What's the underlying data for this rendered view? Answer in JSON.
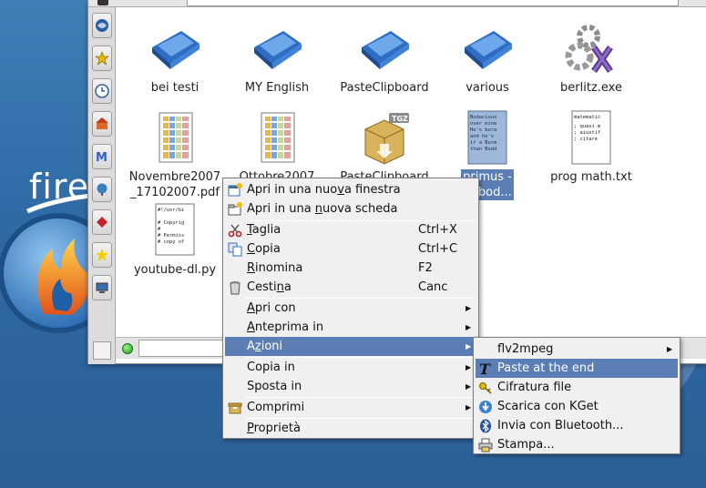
{
  "desktop": {
    "logo_text": "fire"
  },
  "files": [
    {
      "label": "bei testi",
      "icon": "blue-folder-icon"
    },
    {
      "label": "MY English",
      "icon": "blue-folder-icon"
    },
    {
      "label": "PasteClipboard",
      "icon": "blue-folder-icon"
    },
    {
      "label": "various",
      "icon": "blue-folder-icon"
    },
    {
      "label": "berlitz.exe",
      "icon": "gear-executable-icon"
    },
    {
      "label": "Novembre2007",
      "label2": "_17102007.pdf",
      "icon": "pdf-document-icon"
    },
    {
      "label": "Ottobre2007",
      "icon": "pdf-document-icon"
    },
    {
      "label": "PasteClipboard",
      "icon": "tgz-archive-icon"
    },
    {
      "label": "primus -",
      "label2": "of bod...",
      "icon": "text-file-preview-icon",
      "preview": [
        "Bodacious",
        "over mine",
        "He's bora",
        "and he's",
        "if a Burm",
        "than Bodd"
      ]
    },
    {
      "label": "prog math.txt",
      "icon": "text-file-preview-icon",
      "preview": [
        "matematic",
        ";  quasi m",
        ";  aiustif",
        ";  citare"
      ]
    },
    {
      "label": "youtube-dl.py",
      "icon": "python-script-icon",
      "preview": [
        "#!/usr/bi",
        "",
        "# Copyrig",
        "#",
        "# Permiss",
        "# copy of"
      ]
    }
  ],
  "context_menu": {
    "new_window": {
      "pre": "Apri in una nuo",
      "mn": "v",
      "post": "a finestra"
    },
    "new_tab": {
      "pre": "Apri in una ",
      "mn": "n",
      "post": "uova scheda"
    },
    "cut": {
      "pre": "",
      "mn": "T",
      "post": "aglia",
      "shortcut": "Ctrl+X"
    },
    "copy": {
      "pre": "",
      "mn": "C",
      "post": "opia",
      "shortcut": "Ctrl+C"
    },
    "rename": {
      "pre": "",
      "mn": "R",
      "post": "inomina",
      "shortcut": "F2"
    },
    "trash": {
      "pre": "Cesti",
      "mn": "n",
      "post": "a",
      "shortcut": "Canc"
    },
    "open_with": {
      "pre": "",
      "mn": "A",
      "post": "pri con"
    },
    "preview_in": {
      "pre": "",
      "mn": "A",
      "post": "nteprima in"
    },
    "actions": {
      "pre": "A",
      "mn": "z",
      "post": "ioni"
    },
    "copy_to": {
      "pre": "Copia in",
      "mn": "",
      "post": ""
    },
    "move_to": {
      "pre": "Sposta in",
      "mn": "",
      "post": ""
    },
    "compress": {
      "pre": "Comprimi",
      "mn": "",
      "post": ""
    },
    "properties": {
      "pre": "",
      "mn": "P",
      "post": "roprietà"
    }
  },
  "actions_submenu": {
    "flv2mpeg": "flv2mpeg",
    "paste_end": "Paste at the end",
    "encrypt": "Cifratura file",
    "kget": "Scarica con KGet",
    "bluetooth": "Invia con Bluetooth...",
    "print": "Stampa..."
  },
  "colors": {
    "highlight": "#5b7fb4",
    "menu_bg": "#f0f0f0",
    "desktop": "#2f6aa6"
  }
}
